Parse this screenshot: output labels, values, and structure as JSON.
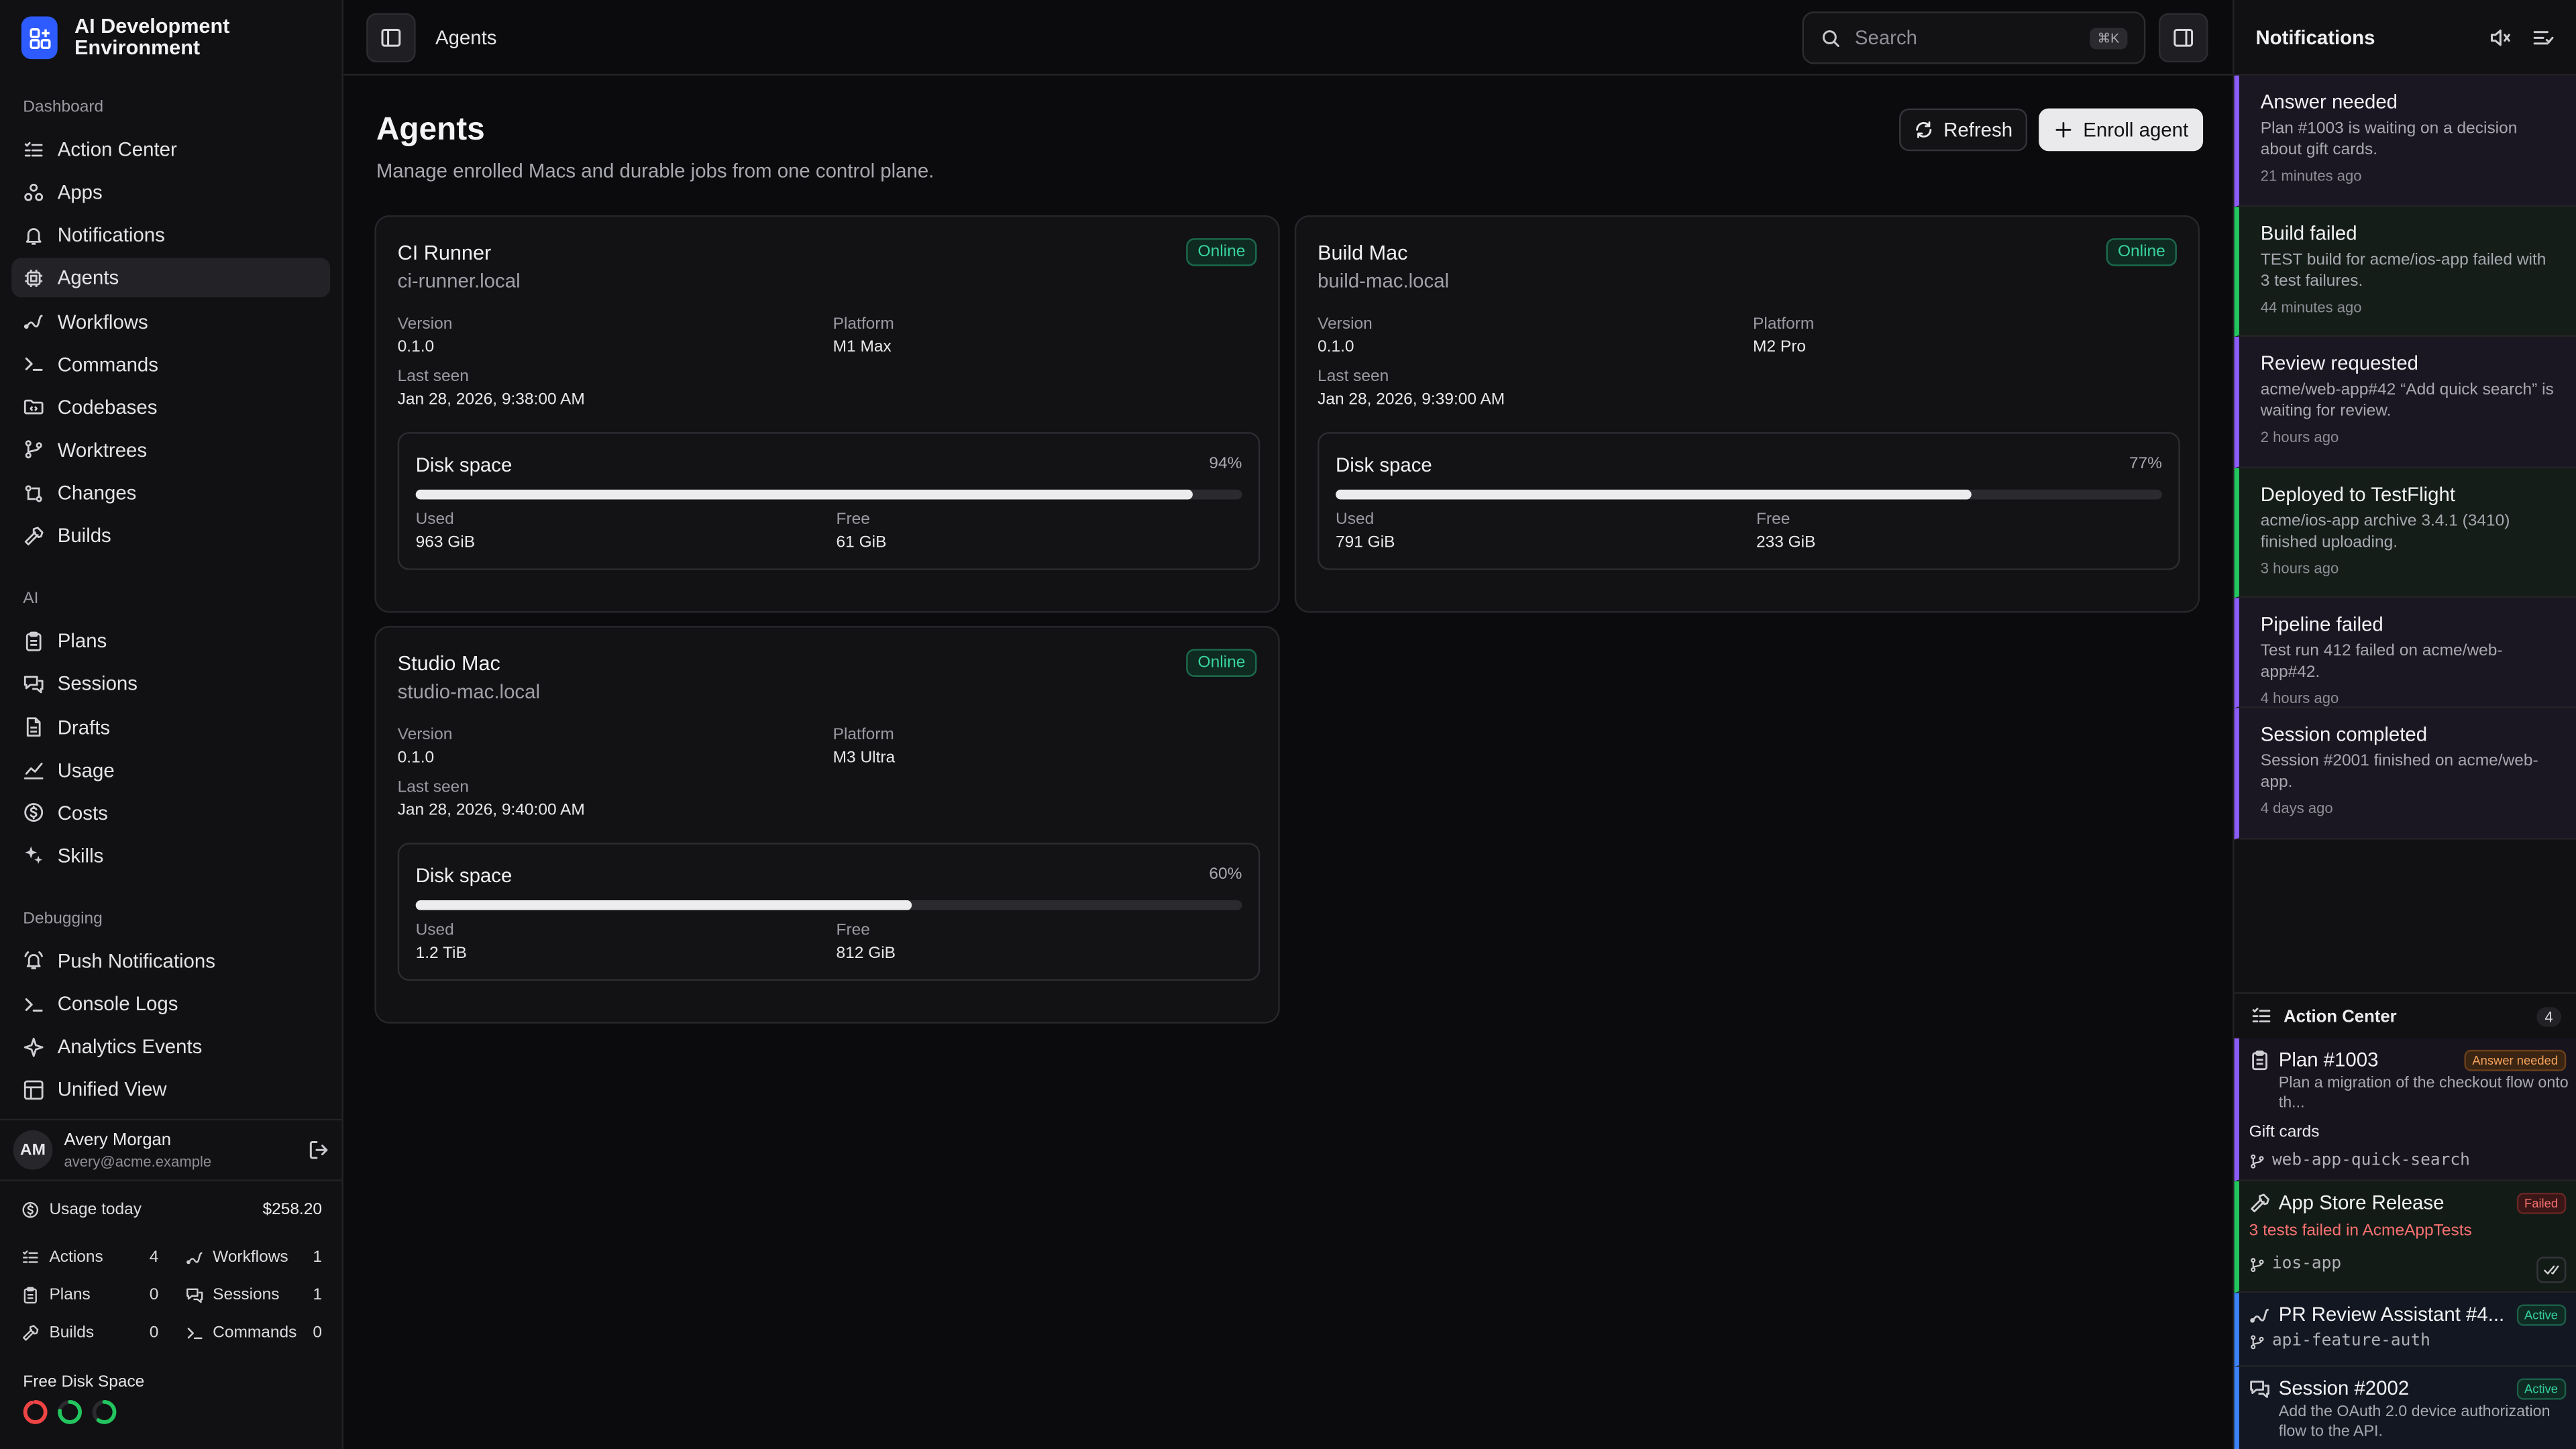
{
  "app": {
    "name": "AI Development Environment"
  },
  "sidebar": {
    "sections": [
      {
        "title": "Dashboard",
        "items": [
          {
            "label": "Action Center",
            "icon": "list-checks-icon"
          },
          {
            "label": "Apps",
            "icon": "apps-icon"
          },
          {
            "label": "Notifications",
            "icon": "bell-icon"
          },
          {
            "label": "Agents",
            "icon": "cpu-icon",
            "active": true
          },
          {
            "label": "Workflows",
            "icon": "workflow-icon"
          },
          {
            "label": "Commands",
            "icon": "terminal-icon"
          },
          {
            "label": "Codebases",
            "icon": "folder-code-icon"
          },
          {
            "label": "Worktrees",
            "icon": "git-branch-icon"
          },
          {
            "label": "Changes",
            "icon": "git-compare-icon"
          },
          {
            "label": "Builds",
            "icon": "hammer-icon"
          }
        ]
      },
      {
        "title": "AI",
        "items": [
          {
            "label": "Plans",
            "icon": "clipboard-icon"
          },
          {
            "label": "Sessions",
            "icon": "chat-icon"
          },
          {
            "label": "Drafts",
            "icon": "document-icon"
          },
          {
            "label": "Usage",
            "icon": "chart-icon"
          },
          {
            "label": "Costs",
            "icon": "dollar-icon"
          },
          {
            "label": "Skills",
            "icon": "sparkles-icon"
          }
        ]
      },
      {
        "title": "Debugging",
        "items": [
          {
            "label": "Push Notifications",
            "icon": "bell-ring-icon"
          },
          {
            "label": "Console Logs",
            "icon": "terminal-icon"
          },
          {
            "label": "Analytics Events",
            "icon": "sparkle-icon"
          },
          {
            "label": "Unified View",
            "icon": "layout-icon"
          }
        ]
      }
    ],
    "user": {
      "initials": "AM",
      "name": "Avery Morgan",
      "email": "avery@acme.example"
    },
    "usage": {
      "label": "Usage today",
      "value": "$258.20"
    },
    "stats": [
      {
        "label": "Actions",
        "value": "4",
        "icon": "list-checks-icon"
      },
      {
        "label": "Workflows",
        "value": "1",
        "icon": "workflow-icon"
      },
      {
        "label": "Plans",
        "value": "0",
        "icon": "clipboard-icon"
      },
      {
        "label": "Sessions",
        "value": "1",
        "icon": "chat-icon"
      },
      {
        "label": "Builds",
        "value": "0",
        "icon": "hammer-icon"
      },
      {
        "label": "Commands",
        "value": "0",
        "icon": "terminal-icon"
      }
    ],
    "disk": {
      "title": "Free Disk Space",
      "rings": [
        {
          "fraction": 0.06,
          "color": "#ef4444"
        },
        {
          "fraction": 0.23,
          "color": "#22c55e"
        },
        {
          "fraction": 0.4,
          "color": "#22c55e"
        }
      ]
    }
  },
  "topbar": {
    "breadcrumb": "Agents",
    "search_placeholder": "Search",
    "search_shortcut": "⌘K"
  },
  "page": {
    "title": "Agents",
    "subtitle": "Manage enrolled Macs and durable jobs from one control plane.",
    "refresh_label": "Refresh",
    "enroll_label": "Enroll agent"
  },
  "agents": [
    {
      "name": "CI Runner",
      "host": "ci-runner.local",
      "status": "Online",
      "version_label": "Version",
      "version": "0.1.0",
      "platform_label": "Platform",
      "platform": "M1 Max",
      "last_seen_label": "Last seen",
      "last_seen": "Jan 28, 2026, 9:38:00 AM",
      "disk_label": "Disk space",
      "disk_percent_text": "94%",
      "disk_fraction": 0.94,
      "used_label": "Used",
      "used": "963 GiB",
      "free_label": "Free",
      "free": "61 GiB"
    },
    {
      "name": "Build Mac",
      "host": "build-mac.local",
      "status": "Online",
      "version_label": "Version",
      "version": "0.1.0",
      "platform_label": "Platform",
      "platform": "M2 Pro",
      "last_seen_label": "Last seen",
      "last_seen": "Jan 28, 2026, 9:39:00 AM",
      "disk_label": "Disk space",
      "disk_percent_text": "77%",
      "disk_fraction": 0.77,
      "used_label": "Used",
      "used": "791 GiB",
      "free_label": "Free",
      "free": "233 GiB"
    },
    {
      "name": "Studio Mac",
      "host": "studio-mac.local",
      "status": "Online",
      "version_label": "Version",
      "version": "0.1.0",
      "platform_label": "Platform",
      "platform": "M3 Ultra",
      "last_seen_label": "Last seen",
      "last_seen": "Jan 28, 2026, 9:40:00 AM",
      "disk_label": "Disk space",
      "disk_percent_text": "60%",
      "disk_fraction": 0.6,
      "used_label": "Used",
      "used": "1.2 TiB",
      "free_label": "Free",
      "free": "812 GiB"
    }
  ],
  "notifications": {
    "title": "Notifications",
    "items": [
      {
        "title": "Answer needed",
        "body": "Plan #1003 is waiting on a decision about gift cards.",
        "time": "21 minutes ago",
        "tone": "purple"
      },
      {
        "title": "Build failed",
        "body": "TEST build for acme/ios-app failed with 3 test failures.",
        "time": "44 minutes ago",
        "tone": "green"
      },
      {
        "title": "Review requested",
        "body": "acme/web-app#42 “Add quick search” is waiting for review.",
        "time": "2 hours ago",
        "tone": "purple"
      },
      {
        "title": "Deployed to TestFlight",
        "body": "acme/ios-app archive 3.4.1 (3410) finished uploading.",
        "time": "3 hours ago",
        "tone": "green"
      },
      {
        "title": "Pipeline failed",
        "body": "Test run 412 failed on acme/web-app#42.",
        "time": "4 hours ago",
        "tone": "purple"
      },
      {
        "title": "Session completed",
        "body": "Session #2001 finished on acme/web-app.",
        "time": "4 days ago",
        "tone": "purple"
      }
    ]
  },
  "action_center": {
    "title": "Action Center",
    "count": "4",
    "items": [
      {
        "name": "Plan #1003",
        "tag": "Answer needed",
        "desc": "Plan a migration of the checkout flow onto th...",
        "extra": "Gift cards",
        "branch": "web-app-quick-search"
      },
      {
        "name": "App Store Release",
        "tag": "Failed",
        "error": "3 tests failed in AcmeAppTests",
        "branch": "ios-app"
      },
      {
        "name": "PR Review Assistant #4...",
        "tag": "Active",
        "branch": "api-feature-auth"
      },
      {
        "name": "Session #2002",
        "tag": "Active",
        "desc": "Add the OAuth 2.0 device authorization flow to the API."
      }
    ]
  }
}
